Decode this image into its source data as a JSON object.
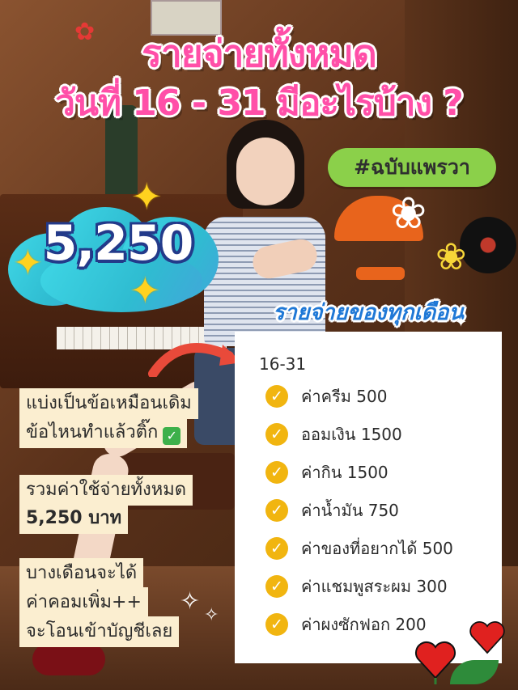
{
  "title": {
    "line1": "รายจ่ายทั้งหมด",
    "line2": "วันที่ 16 - 31 มีอะไรบ้าง ?"
  },
  "hashtag": "#ฉบับแพรวา",
  "total_amount": "5,250",
  "subheading": "รายจ่ายของทุกเดือน",
  "expense_list": {
    "range": "16-31",
    "items": [
      "ค่าครีม 500",
      "ออมเงิน 1500",
      "ค่ากิน 1500",
      "ค่าน้ำมัน 750",
      "ค่าของที่อยากได้ 500",
      "ค่าแชมพูสระผม 300",
      "ค่าผงซักฟอก 200"
    ]
  },
  "notes": {
    "split_line1": "แบ่งเป็นข้อเหมือนเดิม",
    "split_line2": "ข้อไหนทำแล้วติ๊ก",
    "total_line1": "รวมค่าใช้จ่ายทั้งหมด",
    "total_line2": "5,250 บาท",
    "bonus_line1": "บางเดือนจะได้",
    "bonus_line2": "ค่าคอมเพิ่ม++",
    "bonus_line3": "จะโอนเข้าบัญชีเลย"
  },
  "colors": {
    "title_pink": "#ff4fa8",
    "hashtag_green": "#8bd04a",
    "subheading_blue": "#1f78d6",
    "check_yellow": "#f1b510",
    "note_bg": "#fbeed0",
    "cloud_teal": "#3fd7e6"
  },
  "icons": {
    "check": "check-circle-icon",
    "checkbox_emoji": "green-checkbox-icon",
    "sparkle": "sparkle-star-icon",
    "arrow": "curved-arrow-icon",
    "hearts": "heart-icon"
  }
}
